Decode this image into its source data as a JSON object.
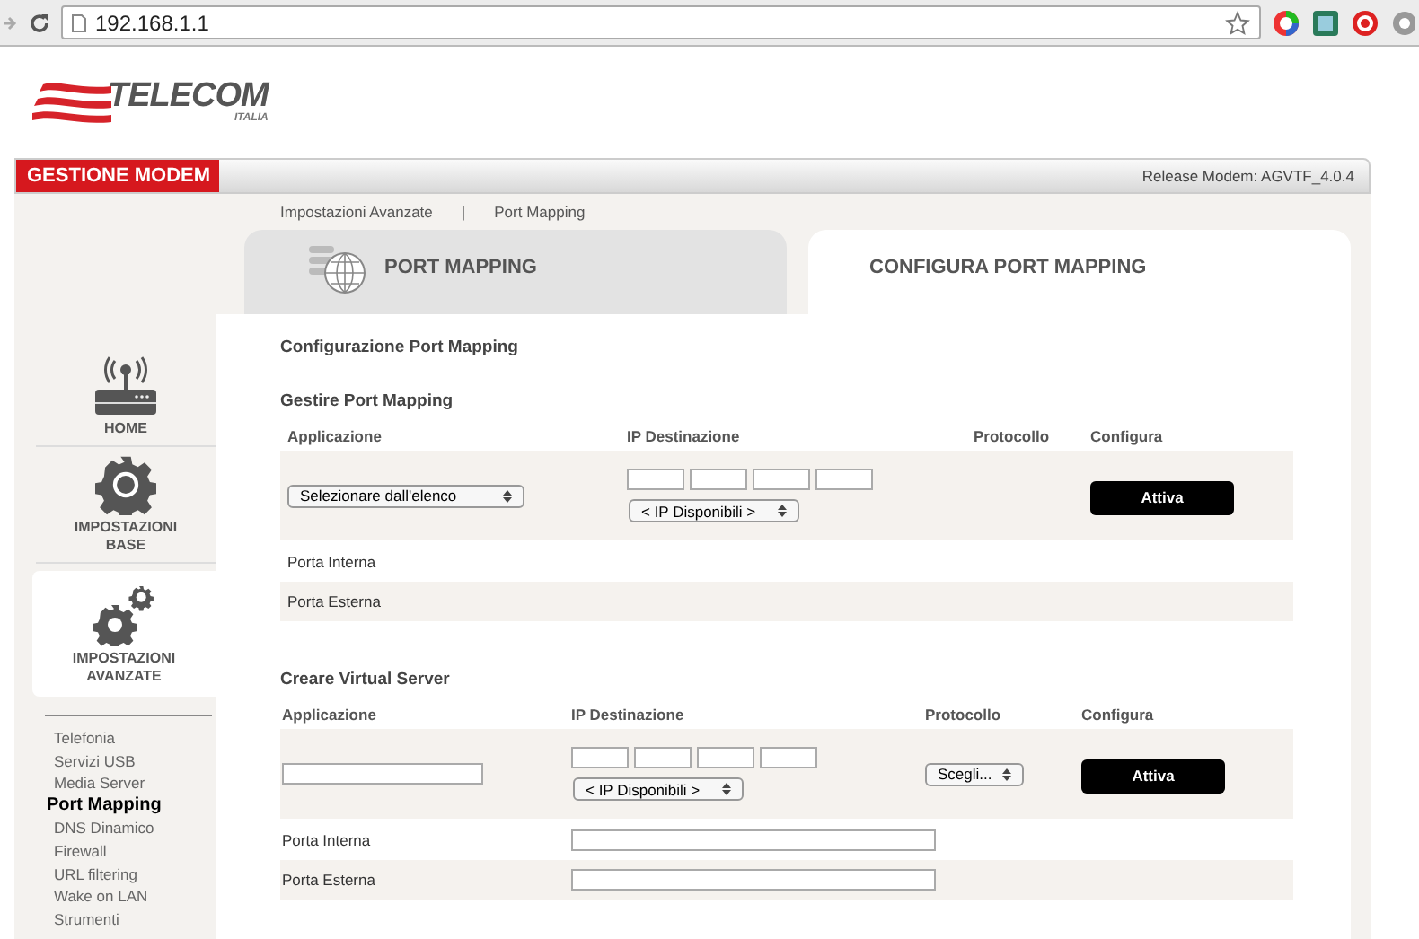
{
  "browser": {
    "url": "192.168.1.1"
  },
  "logo": {
    "name": "TELECOM",
    "sub": "ITALIA"
  },
  "header": {
    "title": "GESTIONE MODEM",
    "release": "Release Modem: AGVTF_4.0.4"
  },
  "sidebar": {
    "sections": [
      {
        "label": "HOME",
        "kind": "home",
        "selected": false
      },
      {
        "label": "IMPOSTAZIONI BASE",
        "kind": "gear",
        "selected": false
      },
      {
        "label": "IMPOSTAZIONI AVANZATE",
        "kind": "gears",
        "selected": true
      }
    ],
    "submenu": [
      {
        "label": "Telefonia",
        "selected": false
      },
      {
        "label": "Servizi USB",
        "selected": false
      },
      {
        "label": "Media Server",
        "selected": false
      },
      {
        "label": "Port Mapping",
        "selected": true
      },
      {
        "label": "DNS Dinamico",
        "selected": false
      },
      {
        "label": "Firewall",
        "selected": false
      },
      {
        "label": "URL filtering",
        "selected": false
      },
      {
        "label": "Wake on LAN",
        "selected": false
      },
      {
        "label": "Strumenti",
        "selected": false
      }
    ]
  },
  "breadcrumb": [
    "Impostazioni Avanzate",
    "|",
    "Port Mapping"
  ],
  "tabs": [
    {
      "label": "PORT MAPPING",
      "selected": false
    },
    {
      "label": "CONFIGURA PORT MAPPING",
      "selected": true
    }
  ],
  "page_title": "Configurazione Port Mapping",
  "sections": [
    {
      "kind": "manage",
      "title": "Gestire Port Mapping",
      "columns": [
        "Applicazione",
        "IP Destinazione",
        "Protocollo",
        "Configura"
      ],
      "application": {
        "kind": "select",
        "value": "Selezionare dall'elenco"
      },
      "ip_picker": "< IP Disponibili >",
      "button": "Attiva",
      "rows": [
        {
          "label": "Porta Interna",
          "field": false
        },
        {
          "label": "Porta Esterna",
          "field": false
        }
      ]
    },
    {
      "kind": "create",
      "title": "Creare Virtual Server",
      "columns": [
        "Applicazione",
        "IP Destinazione",
        "Protocollo",
        "Configura"
      ],
      "application": {
        "kind": "input"
      },
      "ip_picker": "< IP Disponibili >",
      "protocol": "Scegli...",
      "button": "Attiva",
      "rows": [
        {
          "label": "Porta Interna",
          "field": true
        },
        {
          "label": "Porta Esterna",
          "field": true
        }
      ]
    }
  ]
}
